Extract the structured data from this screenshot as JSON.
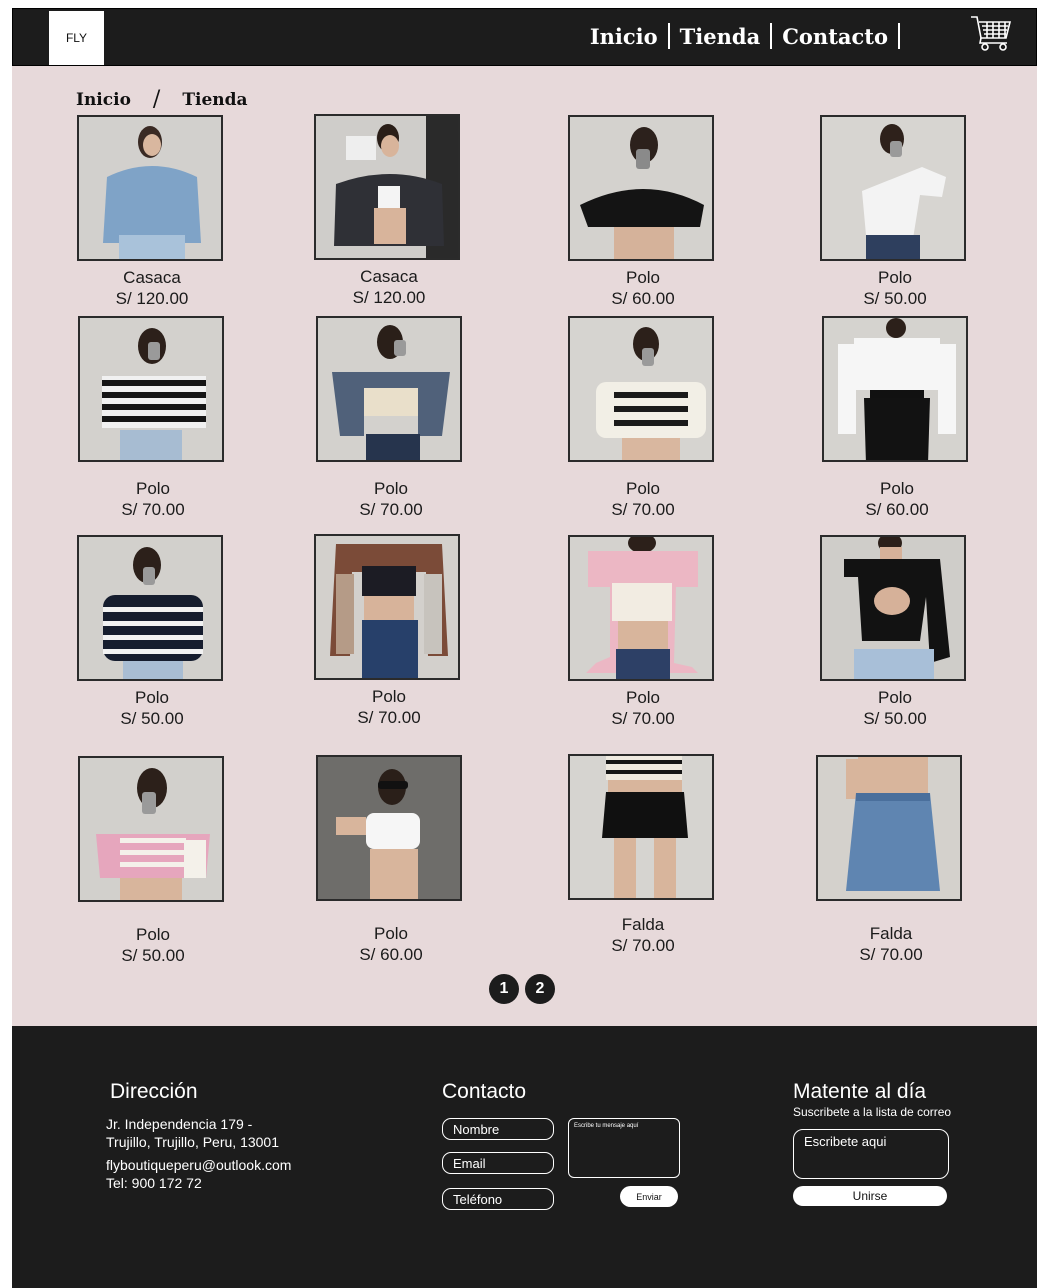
{
  "header": {
    "logo": "FLY",
    "nav": [
      {
        "label": "Inicio"
      },
      {
        "label": "Tienda"
      },
      {
        "label": "Contacto"
      }
    ],
    "cart_icon": "shopping-cart-icon"
  },
  "breadcrumb": {
    "home": "Inicio",
    "separator": "/",
    "current": "Tienda"
  },
  "products": [
    {
      "name": "Casaca",
      "price": "S/ 120.00"
    },
    {
      "name": "Casaca",
      "price": "S/ 120.00"
    },
    {
      "name": "Polo",
      "price": "S/ 60.00"
    },
    {
      "name": "Polo",
      "price": "S/ 50.00"
    },
    {
      "name": "Polo",
      "price": "S/ 70.00"
    },
    {
      "name": "Polo",
      "price": "S/ 70.00"
    },
    {
      "name": "Polo",
      "price": "S/ 70.00"
    },
    {
      "name": "Polo",
      "price": "S/ 60.00"
    },
    {
      "name": "Polo",
      "price": "S/ 50.00"
    },
    {
      "name": "Polo",
      "price": "S/ 70.00"
    },
    {
      "name": "Polo",
      "price": "S/ 70.00"
    },
    {
      "name": "Polo",
      "price": "S/ 50.00"
    },
    {
      "name": "Polo",
      "price": "S/ 50.00"
    },
    {
      "name": "Polo",
      "price": "S/ 60.00"
    },
    {
      "name": "Falda",
      "price": "S/ 70.00"
    },
    {
      "name": "Falda",
      "price": "S/ 70.00"
    }
  ],
  "pagination": [
    "1",
    "2"
  ],
  "footer": {
    "address": {
      "heading": "Dirección",
      "line1": "Jr. Independencia 179 -",
      "line2": "Trujillo, Trujillo, Peru, 13001",
      "email": "flyboutiqueperu@outlook.com",
      "phone": "Tel: 900 172 72"
    },
    "contact": {
      "heading": "Contacto",
      "name_placeholder": "Nombre",
      "email_placeholder": "Email",
      "phone_placeholder": "Teléfono",
      "message_placeholder": "Escribe tu mensaje aquí",
      "send_label": "Enviar"
    },
    "newsletter": {
      "heading": "Matente al día",
      "subheading": "Suscribete a la lista de correo",
      "input_placeholder": "Escribete aqui",
      "join_label": "Unirse"
    }
  },
  "colors": {
    "dark": "#1c1c1c",
    "page_background": "#e7d9da",
    "white": "#ffffff"
  }
}
